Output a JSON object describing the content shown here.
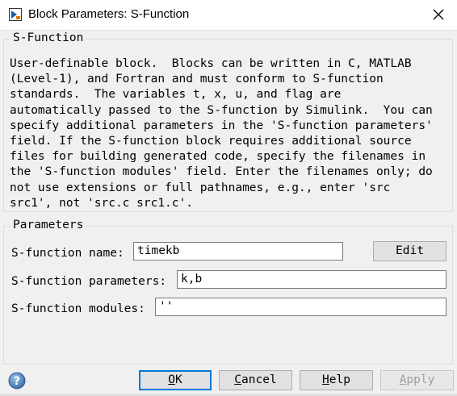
{
  "window": {
    "title": "Block Parameters: S-Function",
    "icons": [
      "simulink-block-icon",
      "close-icon",
      "help-icon"
    ]
  },
  "sfunction_group": {
    "title": "S-Function",
    "description": "User-definable block.  Blocks can be written in C, MATLAB\n(Level-1), and Fortran and must conform to S-function\nstandards.  The variables t, x, u, and flag are\nautomatically passed to the S-function by Simulink.  You can\nspecify additional parameters in the 'S-function parameters'\nfield. If the S-function block requires additional source\nfiles for building generated code, specify the filenames in\nthe 'S-function modules' field. Enter the filenames only; do\nnot use extensions or full pathnames, e.g., enter 'src\nsrc1', not 'src.c src1.c'."
  },
  "parameters_group": {
    "title": "Parameters",
    "name_label": "S-function name:",
    "name_value": "timekb",
    "edit_label": "Edit",
    "params_label": "S-function parameters:",
    "params_value": "k,b",
    "modules_label": "S-function modules:",
    "modules_value": "''"
  },
  "buttons": {
    "ok": {
      "mnemonic": "O",
      "rest": "K"
    },
    "cancel": {
      "mnemonic": "C",
      "rest": "ancel"
    },
    "help": {
      "mnemonic": "H",
      "rest": "elp"
    },
    "apply": {
      "mnemonic": "A",
      "rest": "pply"
    }
  },
  "colors": {
    "background": "#f0f0f0",
    "focus_border": "#0078d7",
    "disabled_text": "#a0a0a0"
  }
}
